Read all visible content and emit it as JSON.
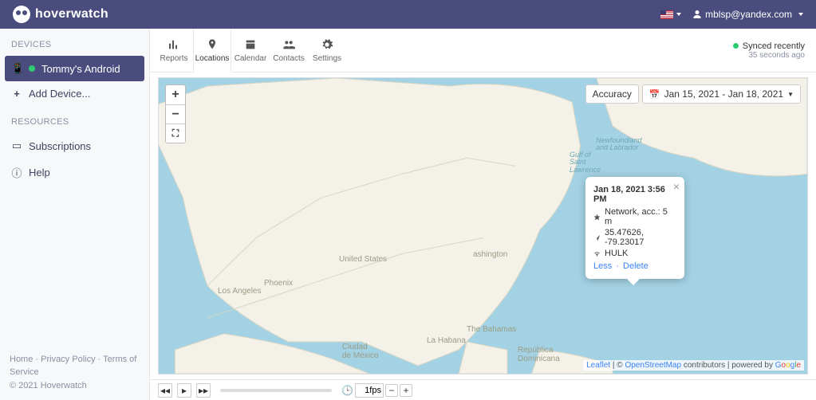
{
  "header": {
    "brand": "hoverwatch",
    "user_email": "mblsp@yandex.com"
  },
  "sidebar": {
    "sections": {
      "devices": "DEVICES",
      "resources": "RESOURCES"
    },
    "device_label": "Tommy's Android",
    "add_device": "Add Device...",
    "subscriptions": "Subscriptions",
    "help": "Help",
    "footer_links": {
      "home": "Home",
      "privacy": "Privacy Policy",
      "terms": "Terms of Service"
    },
    "copyright": "© 2021 Hoverwatch"
  },
  "topbar": {
    "tabs": {
      "reports": "Reports",
      "locations": "Locations",
      "calendar": "Calendar",
      "contacts": "Contacts",
      "settings": "Settings"
    },
    "sync_status": "Synced recently",
    "sync_sub": "35 seconds ago"
  },
  "map": {
    "accuracy_label": "Accuracy",
    "date_range": "Jan 15, 2021 - Jan 18, 2021",
    "labels": {
      "us": "United States",
      "phoenix": "Phoenix",
      "la": "Los Angeles",
      "ciudad": "Ciudad\nde México",
      "havana": "La Habana",
      "bahamas": "The Bahamas",
      "dr": "República\nDominicana",
      "ashington": "ashington",
      "gulf": "Gulf of\nSaint\nLawrence",
      "nf": "Newfoundland\nand Labrador"
    },
    "popup": {
      "timestamp": "Jan 18, 2021 3:56 PM",
      "network": "Network, acc.: 5 m",
      "coords": "35.47626, -79.23017",
      "wifi": "HULK",
      "less": "Less",
      "del": "Delete"
    },
    "attrib": {
      "leaflet": "Leaflet",
      "osm": "OpenStreetMap",
      "contrib": " contributors",
      "powered": "powered by ",
      "google": "Google"
    },
    "fps": "1fps"
  }
}
